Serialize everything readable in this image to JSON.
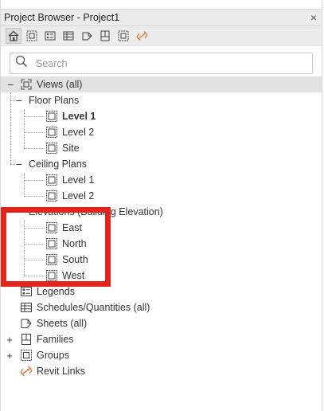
{
  "window": {
    "title": "Project Browser - Project1",
    "close_glyph": "×"
  },
  "toolbar": {
    "icons": [
      "home-icon",
      "view-icon",
      "legend-icon",
      "schedule-icon",
      "sheet-icon",
      "family-icon",
      "group-icon",
      "link-icon"
    ]
  },
  "search": {
    "placeholder": "Search",
    "value": ""
  },
  "tree": {
    "views": {
      "label": "Views (all)",
      "toggle": "−"
    },
    "floor_plans": {
      "label": "Floor Plans",
      "toggle": "−",
      "items": [
        "Level 1",
        "Level 2",
        "Site"
      ]
    },
    "ceiling_plans": {
      "label": "Ceiling Plans",
      "toggle": "−",
      "items": [
        "Level 1",
        "Level 2"
      ]
    },
    "elevations": {
      "label": "Elevations (Building Elevation)",
      "items": [
        "East",
        "North",
        "South",
        "West"
      ]
    },
    "legends": {
      "label": "Legends"
    },
    "schedules": {
      "label": "Schedules/Quantities (all)"
    },
    "sheets": {
      "label": "Sheets (all)"
    },
    "families": {
      "label": "Families",
      "toggle": "+"
    },
    "groups": {
      "label": "Groups",
      "toggle": "+"
    },
    "revit_links": {
      "label": "Revit Links"
    }
  },
  "colors": {
    "highlight_box": "#e3241b",
    "link_icon": "#e07a2e",
    "title_bg": "#ececec"
  }
}
